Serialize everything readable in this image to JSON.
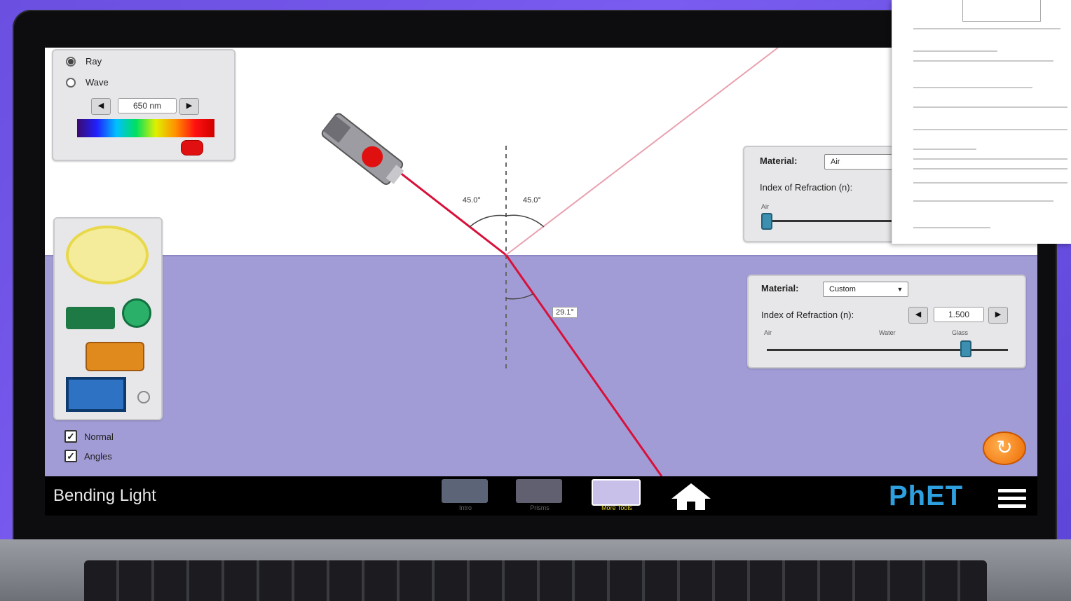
{
  "sim": {
    "title": "Bending Light",
    "light_panel": {
      "options": [
        {
          "label": "Ray",
          "selected": true
        },
        {
          "label": "Wave",
          "selected": false
        }
      ],
      "wavelength_value": "650 nm",
      "laser_color": "#e01010"
    },
    "angles": {
      "incident": "45.0°",
      "reflected": "45.0°",
      "refracted": "29.1°"
    },
    "top_material": {
      "label": "Material:",
      "value": "Air",
      "index_label": "Index of Refraction (n):",
      "slider_left": "Air",
      "slider_value": 1.0
    },
    "bottom_material": {
      "label": "Material:",
      "value": "Custom",
      "index_label": "Index of Refraction (n):",
      "index_value": "1.500",
      "slider_left": "Air",
      "slider_mid": "Water",
      "slider_right": "Glass",
      "slider_value": 1.5
    },
    "checkboxes": [
      {
        "label": "Normal",
        "checked": true
      },
      {
        "label": "Angles",
        "checked": true
      }
    ],
    "screens": [
      {
        "label": "Intro",
        "active": false
      },
      {
        "label": "Prisms",
        "active": false
      },
      {
        "label": "More Tools",
        "active": true
      }
    ],
    "brand": "PhET",
    "colors": {
      "water": "#a29cd6",
      "laser": "#d8103a",
      "phet_blue": "#2ea0e0",
      "active_tab_label": "#e8d22a"
    }
  }
}
